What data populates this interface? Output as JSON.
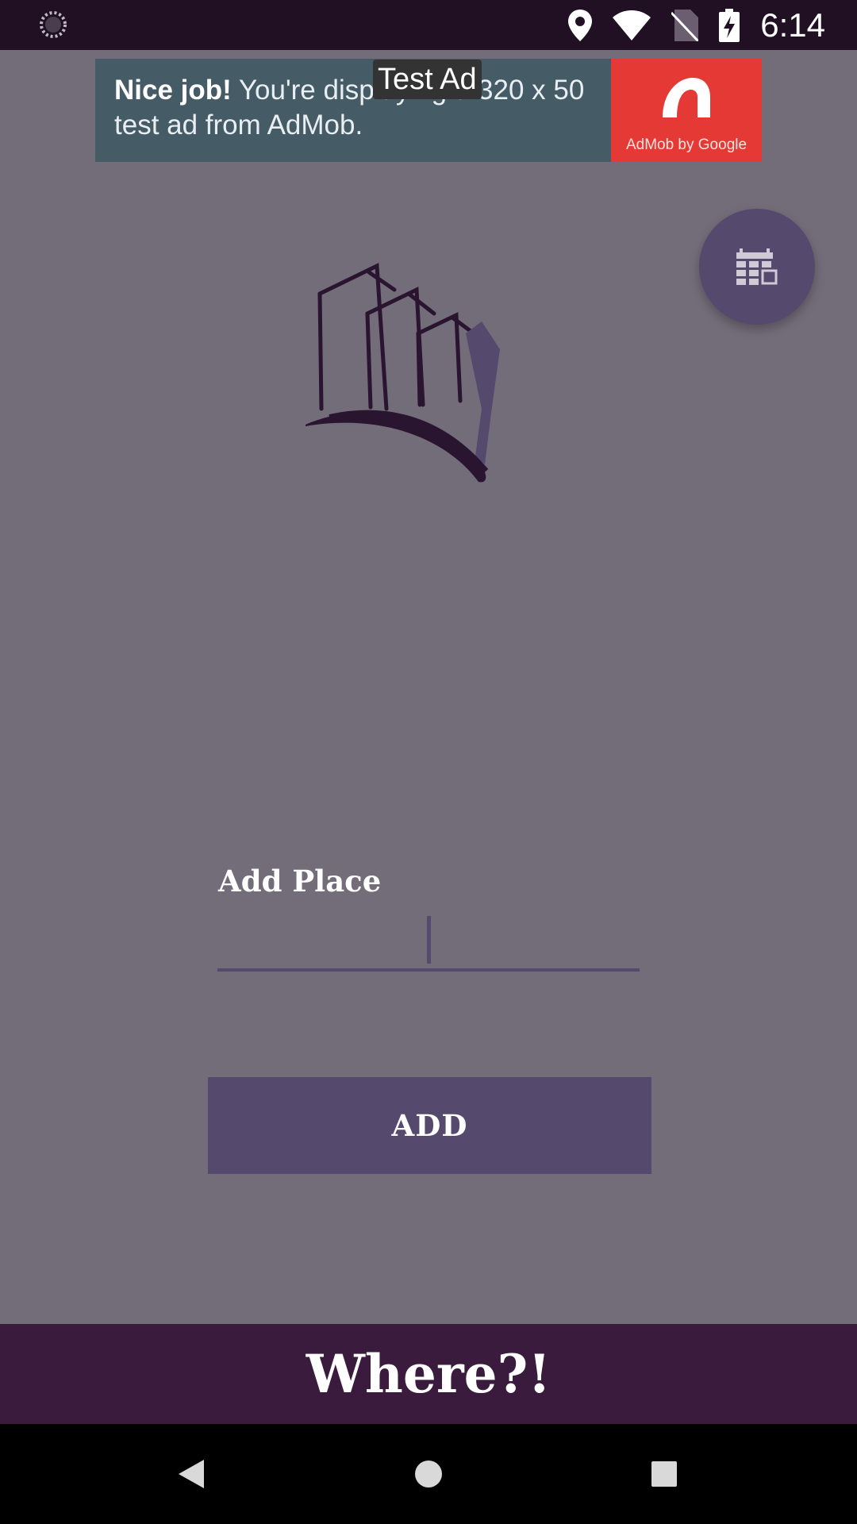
{
  "status_bar": {
    "time": "6:14",
    "icons": [
      "loading-icon",
      "location-icon",
      "wifi-icon",
      "no-sim-icon",
      "battery-charging-icon"
    ]
  },
  "ad": {
    "badge": "Test Ad",
    "headline_bold": "Nice job!",
    "headline_rest": " You're displaying a 320 x 50 test ad from AdMob.",
    "logo_caption": "AdMob by Google"
  },
  "fab": {
    "icon": "calendar-grid-icon"
  },
  "form": {
    "label": "Add Place",
    "input_value": "",
    "button_label": "ADD"
  },
  "footer": {
    "title": "Where?!"
  },
  "nav": {
    "icons": [
      "back-icon",
      "home-icon",
      "recents-icon"
    ]
  },
  "colors": {
    "background": "#736c79",
    "status_bar": "#211024",
    "accent": "#55496d",
    "footer": "#3a1b3d",
    "ad_background": "#455b66",
    "ad_logo": "#e53935"
  }
}
